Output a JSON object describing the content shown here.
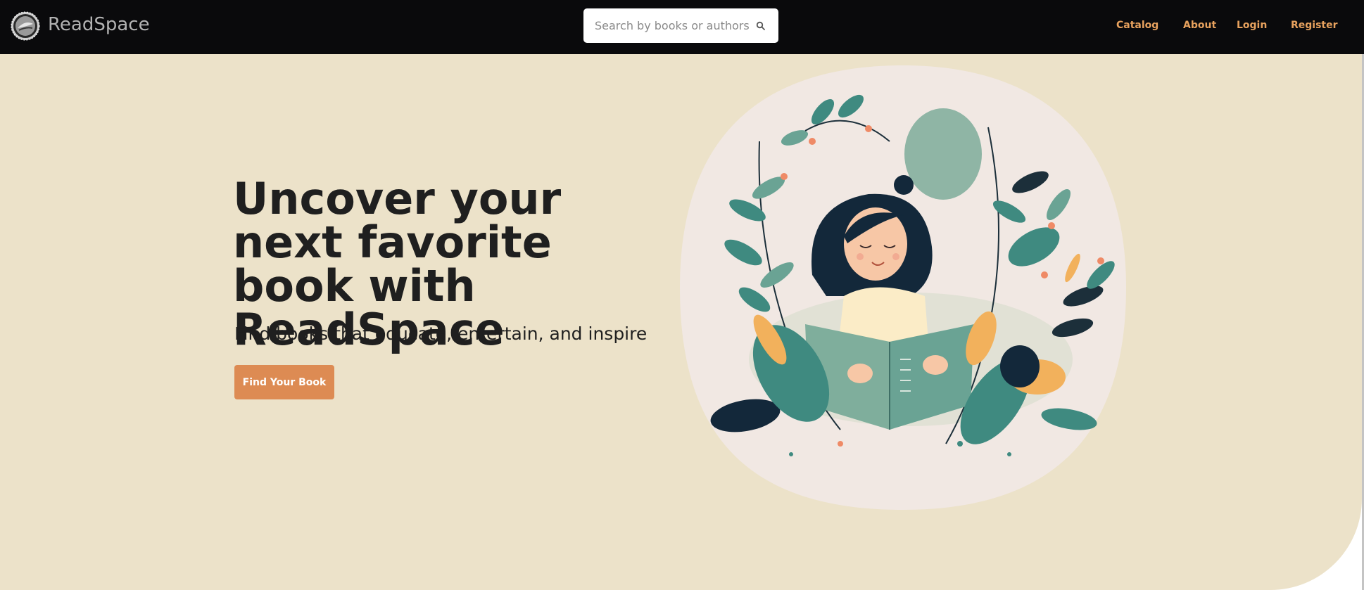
{
  "nav": {
    "brand": "ReadSpace",
    "search_placeholder": "Search by books or authors",
    "links": [
      "Catalog",
      "About",
      "Login",
      "Register"
    ]
  },
  "hero": {
    "headline": "Uncover your next favorite book with ReadSpace",
    "subtitle": "Find books that educate, entertain, and inspire",
    "cta_label": "Find Your Book"
  },
  "colors": {
    "navbar": "#0a0a0c",
    "hero_background": "#ece2c9",
    "accent": "#e8a25e",
    "button": "#dd8b53",
    "illustration_blob": "#f1e8e3"
  },
  "icons": [
    "readspace-logo-icon",
    "search-icon"
  ]
}
